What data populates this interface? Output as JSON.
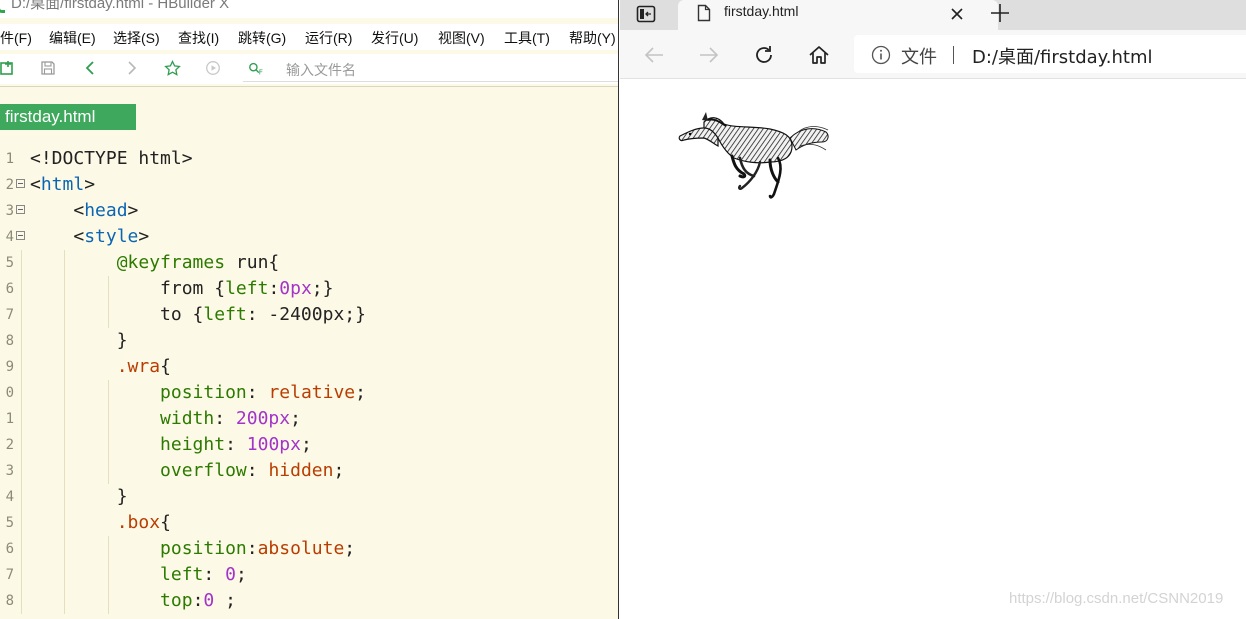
{
  "editor": {
    "title": "D:/桌面/firstday.html - HBuilder X",
    "menu": [
      "件(F)",
      "编辑(E)",
      "选择(S)",
      "查找(I)",
      "跳转(G)",
      "运行(R)",
      "发行(U)",
      "视图(V)",
      "工具(T)",
      "帮助(Y)"
    ],
    "toolbar_icons": [
      "new-file-icon",
      "save-icon",
      "back-icon",
      "forward-icon",
      "star-icon",
      "preview-icon",
      "file-search-icon"
    ],
    "search_placeholder": "输入文件名",
    "open_file_tab": "firstday.html",
    "line_numbers": [
      "1",
      "2",
      "3",
      "4",
      "5",
      "6",
      "7",
      "8",
      "9",
      "0",
      "1",
      "2",
      "3",
      "4",
      "5",
      "6",
      "7",
      "8"
    ],
    "code_lines": [
      [
        {
          "t": "<!DOCTYPE html>",
          "c": "plain"
        }
      ],
      [
        {
          "t": "<",
          "c": "plain"
        },
        {
          "t": "html",
          "c": "tag"
        },
        {
          "t": ">",
          "c": "plain"
        }
      ],
      [
        {
          "t": "    <",
          "c": "plain"
        },
        {
          "t": "head",
          "c": "tag"
        },
        {
          "t": ">",
          "c": "plain"
        }
      ],
      [
        {
          "t": "    <",
          "c": "plain"
        },
        {
          "t": "style",
          "c": "tag"
        },
        {
          "t": ">",
          "c": "plain"
        }
      ],
      [
        {
          "t": "        ",
          "c": "plain"
        },
        {
          "t": "@keyframes",
          "c": "at"
        },
        {
          "t": " run{",
          "c": "plain"
        }
      ],
      [
        {
          "t": "            from {",
          "c": "plain"
        },
        {
          "t": "left",
          "c": "prop"
        },
        {
          "t": ":",
          "c": "plain"
        },
        {
          "t": "0px",
          "c": "num"
        },
        {
          "t": ";}",
          "c": "plain"
        }
      ],
      [
        {
          "t": "            to {",
          "c": "plain"
        },
        {
          "t": "left",
          "c": "prop"
        },
        {
          "t": ": -2400px;}",
          "c": "plain"
        }
      ],
      [
        {
          "t": "        }",
          "c": "plain"
        }
      ],
      [
        {
          "t": "        ",
          "c": "plain"
        },
        {
          "t": ".wra",
          "c": "sel"
        },
        {
          "t": "{",
          "c": "plain"
        }
      ],
      [
        {
          "t": "            ",
          "c": "plain"
        },
        {
          "t": "position",
          "c": "prop"
        },
        {
          "t": ": ",
          "c": "plain"
        },
        {
          "t": "relative",
          "c": "val"
        },
        {
          "t": ";",
          "c": "plain"
        }
      ],
      [
        {
          "t": "            ",
          "c": "plain"
        },
        {
          "t": "width",
          "c": "prop"
        },
        {
          "t": ": ",
          "c": "plain"
        },
        {
          "t": "200px",
          "c": "num"
        },
        {
          "t": ";",
          "c": "plain"
        }
      ],
      [
        {
          "t": "            ",
          "c": "plain"
        },
        {
          "t": "height",
          "c": "prop"
        },
        {
          "t": ": ",
          "c": "plain"
        },
        {
          "t": "100px",
          "c": "num"
        },
        {
          "t": ";",
          "c": "plain"
        }
      ],
      [
        {
          "t": "            ",
          "c": "plain"
        },
        {
          "t": "overflow",
          "c": "prop"
        },
        {
          "t": ": ",
          "c": "plain"
        },
        {
          "t": "hidden",
          "c": "val"
        },
        {
          "t": ";",
          "c": "plain"
        }
      ],
      [
        {
          "t": "        }",
          "c": "plain"
        }
      ],
      [
        {
          "t": "        ",
          "c": "plain"
        },
        {
          "t": ".box",
          "c": "sel"
        },
        {
          "t": "{",
          "c": "plain"
        }
      ],
      [
        {
          "t": "            ",
          "c": "plain"
        },
        {
          "t": "position",
          "c": "prop"
        },
        {
          "t": ":",
          "c": "plain"
        },
        {
          "t": "absolute",
          "c": "val"
        },
        {
          "t": ";",
          "c": "plain"
        }
      ],
      [
        {
          "t": "            ",
          "c": "plain"
        },
        {
          "t": "left",
          "c": "prop"
        },
        {
          "t": ": ",
          "c": "plain"
        },
        {
          "t": "0",
          "c": "num"
        },
        {
          "t": ";",
          "c": "plain"
        }
      ],
      [
        {
          "t": "            ",
          "c": "plain"
        },
        {
          "t": "top",
          "c": "prop"
        },
        {
          "t": ":",
          "c": "plain"
        },
        {
          "t": "0",
          "c": "num"
        },
        {
          "t": " ;",
          "c": "plain"
        }
      ]
    ],
    "folded_lines": [
      2,
      3,
      4
    ]
  },
  "browser": {
    "tab_title": "firstday.html",
    "address_label": "文件",
    "url": "D:/桌面/firstday.html",
    "nav_icons": [
      "back-icon",
      "forward-icon",
      "refresh-icon",
      "home-icon"
    ],
    "content_image": "running-horse"
  },
  "watermark": "https://blog.csdn.net/CSNN2019",
  "colors": {
    "editor_bg": "#fdf9e7",
    "tab_green": "#3ea85c",
    "tag_blue": "#0b66b2",
    "prop_green": "#2c7a00",
    "num_purple": "#a334c9",
    "val_orange": "#b83d00"
  }
}
